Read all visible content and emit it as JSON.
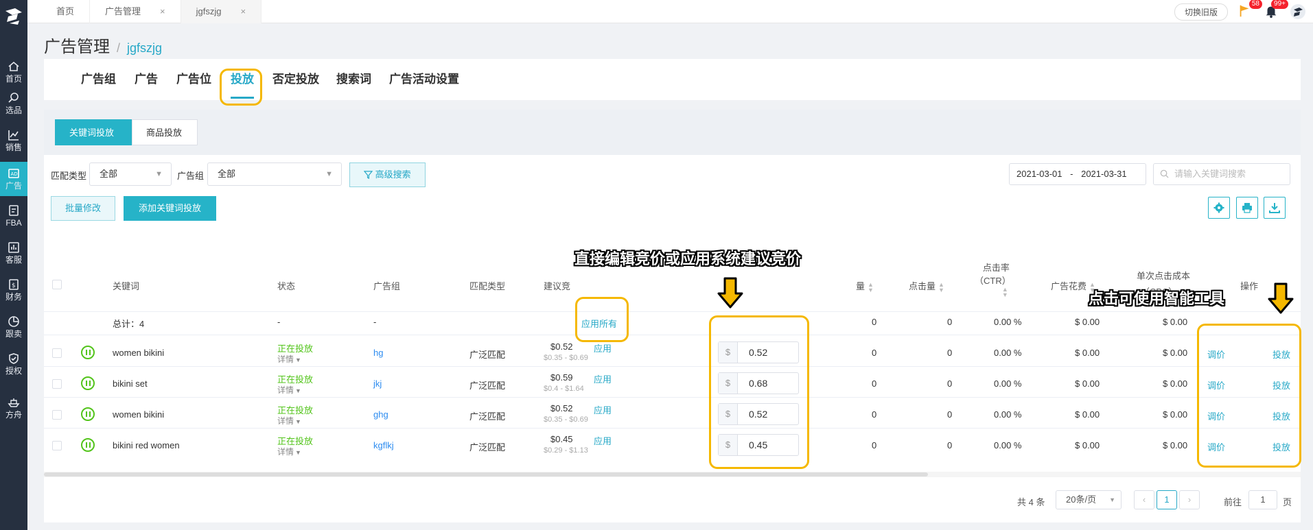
{
  "nav": {
    "items": [
      {
        "label": "首页",
        "icon": "home-icon"
      },
      {
        "label": "选品",
        "icon": "search-icon"
      },
      {
        "label": "销售",
        "icon": "chart-icon"
      },
      {
        "label": "广告",
        "icon": "ad-icon"
      },
      {
        "label": "FBA",
        "icon": "fba-icon"
      },
      {
        "label": "客服",
        "icon": "service-icon"
      },
      {
        "label": "财务",
        "icon": "finance-icon"
      },
      {
        "label": "跟卖",
        "icon": "follow-icon"
      },
      {
        "label": "授权",
        "icon": "shield-icon"
      },
      {
        "label": "方舟",
        "icon": "ark-icon"
      }
    ]
  },
  "topbar": {
    "tabs": [
      {
        "label": "首页"
      },
      {
        "label": "广告管理",
        "close": "×"
      },
      {
        "label": "jgfszjg",
        "close": "×"
      }
    ],
    "switch_label": "切换旧版",
    "flag_count": "58",
    "bell_count": "99+"
  },
  "page": {
    "title": "广告管理",
    "sep": "/",
    "subtitle": "jgfszjg"
  },
  "main_tabs": [
    "广告组",
    "广告",
    "广告位",
    "投放",
    "否定投放",
    "搜索词",
    "广告活动设置"
  ],
  "sub_tabs": [
    "关键词投放",
    "商品投放"
  ],
  "filters": {
    "match_label": "匹配类型",
    "match_value": "全部",
    "group_label": "广告组",
    "group_value": "全部",
    "advanced": "高级搜索",
    "date_from": "2021-03-01",
    "date_sep": "-",
    "date_to": "2021-03-31",
    "search_placeholder": "请输入关键词搜索"
  },
  "actions": {
    "batch": "批量修改",
    "add": "添加关键词投放"
  },
  "table": {
    "headers": {
      "keyword": "关键词",
      "status": "状态",
      "group": "广告组",
      "match": "匹配类型",
      "suggest": "建议竞",
      "impressions": "量",
      "clicks": "点击量",
      "ctr_1": "点击率",
      "ctr_2": "（CTR）",
      "spend": "广告花费",
      "cpc_1": "单次点击成本",
      "cpc_2": "（CPC）",
      "ops": "操作"
    },
    "total": {
      "label": "总计：4",
      "status": "-",
      "group": "-",
      "apply_all": "应用所有",
      "impressions": "0",
      "clicks": "0",
      "ctr": "0.00 %",
      "spend": "$ 0.00",
      "cpc": "$ 0.00"
    },
    "rows": [
      {
        "keyword": "women bikini",
        "status": "正在投放",
        "detail": "详情",
        "group": "hg",
        "match": "广泛匹配",
        "suggest": "$0.52",
        "range": "$0.35 - $0.69",
        "apply": "应用",
        "currency": "$",
        "bid": "0.52",
        "impressions": "0",
        "clicks": "0",
        "ctr": "0.00 %",
        "spend": "$ 0.00",
        "cpc": "$ 0.00",
        "op1": "调价",
        "op2": "投放"
      },
      {
        "keyword": "bikini set",
        "status": "正在投放",
        "detail": "详情",
        "group": "jkj",
        "match": "广泛匹配",
        "suggest": "$0.59",
        "range": "$0.4 - $1.64",
        "apply": "应用",
        "currency": "$",
        "bid": "0.68",
        "impressions": "0",
        "clicks": "0",
        "ctr": "0.00 %",
        "spend": "$ 0.00",
        "cpc": "$ 0.00",
        "op1": "调价",
        "op2": "投放"
      },
      {
        "keyword": "women bikini",
        "status": "正在投放",
        "detail": "详情",
        "group": "ghg",
        "match": "广泛匹配",
        "suggest": "$0.52",
        "range": "$0.35 - $0.69",
        "apply": "应用",
        "currency": "$",
        "bid": "0.52",
        "impressions": "0",
        "clicks": "0",
        "ctr": "0.00 %",
        "spend": "$ 0.00",
        "cpc": "$ 0.00",
        "op1": "调价",
        "op2": "投放"
      },
      {
        "keyword": "bikini red women",
        "status": "正在投放",
        "detail": "详情",
        "group": "kgflkj",
        "match": "广泛匹配",
        "suggest": "$0.45",
        "range": "$0.29 - $1.13",
        "apply": "应用",
        "currency": "$",
        "bid": "0.45",
        "impressions": "0",
        "clicks": "0",
        "ctr": "0.00 %",
        "spend": "$ 0.00",
        "cpc": "$ 0.00",
        "op1": "调价",
        "op2": "投放"
      }
    ]
  },
  "pagination": {
    "total": "共 4 条",
    "page_size": "20条/页",
    "prev": "‹",
    "current": "1",
    "next": "›",
    "goto_label": "前往",
    "goto_value": "1",
    "page_unit": "页"
  },
  "annotations": {
    "bid_tip": "直接编辑竞价或应用系统建议竞价",
    "tool_tip": "点击可使用智能工具",
    "highlight_color": "#f5b800"
  },
  "colors": {
    "accent": "#26b3c8",
    "sidebar": "#263040",
    "running": "#52c41a",
    "link": "#2d8cf0"
  }
}
